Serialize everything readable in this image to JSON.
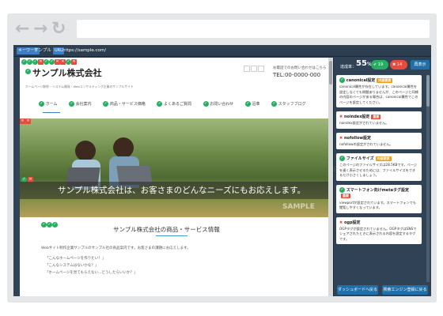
{
  "browser": {
    "url": ""
  },
  "toolbar": {
    "keyword_tag": "キーワード",
    "keyword_value": "サンプル",
    "url_tag": "URL",
    "url_value": "https://sample.com/",
    "score_label": "達成率：",
    "score": "55",
    "score_unit": "%",
    "pass_count": "19",
    "fail_count": "14",
    "detail_button": "再表示"
  },
  "site": {
    "title": "サンプル株式会社",
    "tagline": "ホームページ制作・システム開発・Webコンサルティング企業のサンプルサイト",
    "contact_label": "お電話でのお問い合わせはこちら",
    "phone": "TEL:00-0000-000",
    "nav": [
      "ホーム",
      "会社案内",
      "商品・サービス価格",
      "よくあるご質問",
      "お問い合わせ",
      "沿革",
      "スタッフブログ"
    ],
    "hero_text": "サンプル株式会社は、お客さまのどんなニーズにもお応えします。",
    "hero_watermark": "SAMPLE",
    "section_title": "サンプル株式会社の商品・サービス情報",
    "section_intro": "Webサイト制作企業サンプルのサンプル社の商品案内です。お客さまの課題にお応えします。",
    "quotes": [
      "「こんなホームページを作りたい！」",
      "「こんなシステムはないかな？」",
      "「ホームページを見てもらえない…どうしたらいいか？」"
    ]
  },
  "sidebar": [
    {
      "status": "ok",
      "title": "canonical設定",
      "badge": "内部要素",
      "badge_color": "#f39c12",
      "body": "canonical属性が存在しています。canonical属性を設定しなくても問題ありませんが、このページと同様の内容のページがある場合は、canonical属性でこのページを設定してください。"
    },
    {
      "status": "ng",
      "title": "noindex設定",
      "badge": "重要",
      "badge_color": "#e74c3c",
      "body": "noindex設定がされていません。"
    },
    {
      "status": "ng",
      "title": "nofollow設定",
      "badge": "",
      "badge_color": "",
      "body": "nofollowの設定がされていません。"
    },
    {
      "status": "ok",
      "title": "ファイルサイズ",
      "badge": "内部要素",
      "badge_color": "#f39c12",
      "body": "このページのファイルサイズは28.5KBです。ページを速く表示させるためには、ファイルサイズをできるだけ小さくしましょう。"
    },
    {
      "status": "ok",
      "title": "スマートフォン向けmetaタグ設定",
      "badge": "重要",
      "badge_color": "#e74c3c",
      "body": "viewportが設定されています。スマートフォンでも閲覧しやすくなっています。"
    },
    {
      "status": "ng",
      "title": "ogp設定",
      "badge": "",
      "badge_color": "",
      "body": "OGPタグが設定されていません。OGPタグはSNSでシェアされたときに表示される内容を設定するタグです。"
    }
  ],
  "footer_buttons": [
    "ダッシュボードへ戻る",
    "検索エンジン登録に戻る"
  ]
}
